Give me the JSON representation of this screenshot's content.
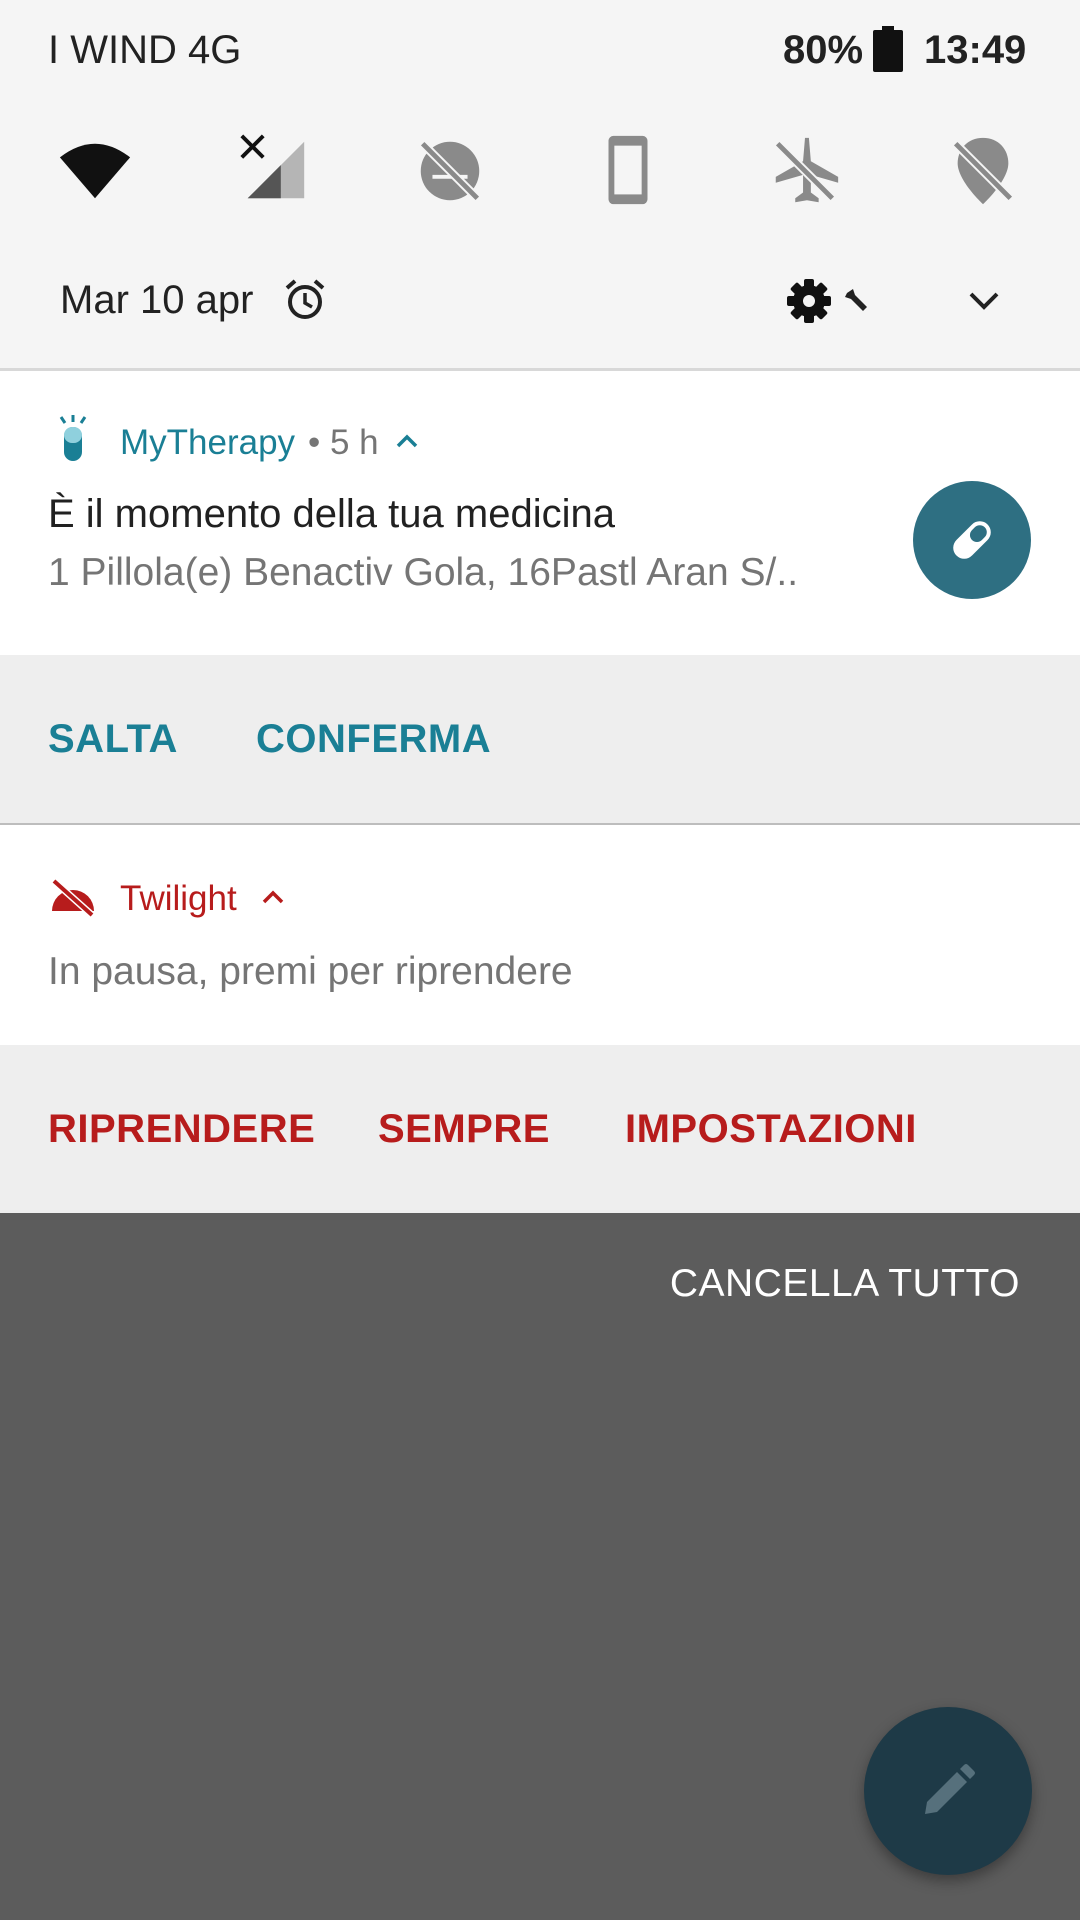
{
  "status_bar": {
    "carrier": "I WIND 4G",
    "battery": "80%",
    "time": "13:49"
  },
  "quick_settings": {
    "tiles": [
      {
        "icon": "wifi-icon"
      },
      {
        "icon": "mobile-data-off-icon"
      },
      {
        "icon": "twilight-paused-icon"
      },
      {
        "icon": "screen-rotation-lock-icon"
      },
      {
        "icon": "airplane-mode-off-icon"
      },
      {
        "icon": "location-off-icon"
      }
    ],
    "date": "Mar 10 apr",
    "alarm_icon": "alarm-icon",
    "settings_icon": "settings-icon",
    "expand_icon": "chevron-down-icon"
  },
  "notifications": [
    {
      "app": "MyTherapy",
      "age": "• 5 h",
      "title": "È il momento della tua medicina",
      "text": "1 Pillola(e) Benactiv Gola, 16Pastl Aran S/..",
      "accent": "#1a7f95",
      "large_icon_color": "#2e6f82",
      "actions": [
        "SALTA",
        "CONFERMA"
      ]
    },
    {
      "app": "Twilight",
      "text": "In pausa, premi per riprendere",
      "accent": "#b71c1c",
      "actions": [
        "RIPRENDERE",
        "SEMPRE",
        "IMPOSTAZIONI"
      ]
    }
  ],
  "clear_all": "CANCELLA TUTTO",
  "fab": {
    "icon": "pencil-icon",
    "color": "#1e3a47"
  }
}
